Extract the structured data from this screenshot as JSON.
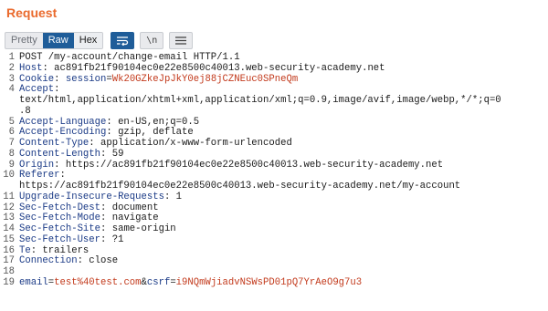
{
  "title": "Request",
  "toolbar": {
    "tabs": [
      {
        "label": "Pretty"
      },
      {
        "label": "Raw"
      },
      {
        "label": "Hex"
      }
    ],
    "newline_label": "\\n"
  },
  "lines": [
    {
      "num": "1",
      "text": "POST /my-account/change-email HTTP/1.1"
    },
    {
      "num": "2",
      "name": "Host",
      "value": " ac891fb21f90104ec0e22e8500c40013.web-security-academy.net"
    },
    {
      "num": "3",
      "name": "Cookie",
      "cookie_name": "session",
      "cookie_value": "Wk20GZkeJpJkY0ej88jCZNEuc0SPneQm"
    },
    {
      "num": "4",
      "name": "Accept",
      "value": ""
    },
    {
      "num": "",
      "text": "text/html,application/xhtml+xml,application/xml;q=0.9,image/avif,image/webp,*/*;q=0"
    },
    {
      "num": "",
      "text": ".8"
    },
    {
      "num": "5",
      "name": "Accept-Language",
      "value": " en-US,en;q=0.5"
    },
    {
      "num": "6",
      "name": "Accept-Encoding",
      "value": " gzip, deflate"
    },
    {
      "num": "7",
      "name": "Content-Type",
      "value": " application/x-www-form-urlencoded"
    },
    {
      "num": "8",
      "name": "Content-Length",
      "value": " 59"
    },
    {
      "num": "9",
      "name": "Origin",
      "value": " https://ac891fb21f90104ec0e22e8500c40013.web-security-academy.net"
    },
    {
      "num": "10",
      "name": "Referer",
      "value": ""
    },
    {
      "num": "",
      "text": "https://ac891fb21f90104ec0e22e8500c40013.web-security-academy.net/my-account"
    },
    {
      "num": "11",
      "name": "Upgrade-Insecure-Requests",
      "value": " 1"
    },
    {
      "num": "12",
      "name": "Sec-Fetch-Dest",
      "value": " document"
    },
    {
      "num": "13",
      "name": "Sec-Fetch-Mode",
      "value": " navigate"
    },
    {
      "num": "14",
      "name": "Sec-Fetch-Site",
      "value": " same-origin"
    },
    {
      "num": "15",
      "name": "Sec-Fetch-User",
      "value": " ?1"
    },
    {
      "num": "16",
      "name": "Te",
      "value": " trailers"
    },
    {
      "num": "17",
      "name": "Connection",
      "value": " close"
    },
    {
      "num": "18",
      "text": ""
    },
    {
      "num": "19",
      "body": [
        {
          "k": "email",
          "v": "test%40test.com"
        },
        {
          "k": "csrf",
          "v": "i9NQmWjiadvNSWsPD01pQ7YrAeO9g7u3"
        }
      ]
    }
  ]
}
